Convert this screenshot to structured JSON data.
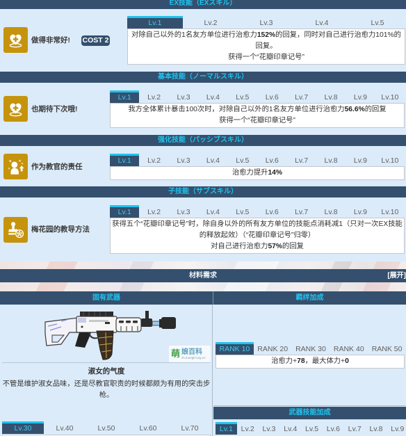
{
  "theme": {
    "header_bg": "#34506e",
    "header_text": "#1fc3ee",
    "accent": "#1fc3ee",
    "active_tab_text": "#45c7ef",
    "icon_bg": "#c6930d",
    "page_bg": "#dcebf9"
  },
  "skills": [
    {
      "header": "EX技能（EXスキル）",
      "icon": "heal-heart-icon",
      "name": "做得非常好!",
      "cost": "COST 2",
      "levels": {
        "labels": [
          "Lv.1",
          "Lv.2",
          "Lv.3",
          "Lv.4",
          "Lv.5"
        ],
        "active": 0
      },
      "description": [
        [
          {
            "text": "对除自己以外的1名友方单位进行治愈力",
            "bold": false
          },
          {
            "text": "152%",
            "bold": true
          },
          {
            "text": "的回复，同时对自己进行治愈力101%的回复。",
            "bold": false
          }
        ],
        [
          {
            "text": "获得一个“花瓣印章记号”",
            "bold": false
          }
        ]
      ]
    },
    {
      "header": "基本技能（ノーマルスキル）",
      "icon": "heal-heart-icon",
      "name": "也期待下次哦!",
      "levels": {
        "labels": [
          "Lv.1",
          "Lv.2",
          "Lv.3",
          "Lv.4",
          "Lv.5",
          "Lv.6",
          "Lv.7",
          "Lv.8",
          "Lv.9",
          "Lv.10"
        ],
        "active": 0
      },
      "description": [
        [
          {
            "text": "我方全体累计暴击100次时，对除自己以外的1名友方单位进行治愈力",
            "bold": false
          },
          {
            "text": "56.6%",
            "bold": true
          },
          {
            "text": "的回复",
            "bold": false
          }
        ],
        [
          {
            "text": "获得一个“花瓣印章记号”",
            "bold": false
          }
        ]
      ]
    },
    {
      "header": "强化技能（パッシブスキル）",
      "icon": "buff-figure-icon",
      "name": "作为教官的责任",
      "levels": {
        "labels": [
          "Lv.1",
          "Lv.2",
          "Lv.3",
          "Lv.4",
          "Lv.5",
          "Lv.6",
          "Lv.7",
          "Lv.8",
          "Lv.9",
          "Lv.10"
        ],
        "active": 0
      },
      "description": [
        [
          {
            "text": "治愈力提升",
            "bold": false
          },
          {
            "text": "14%",
            "bold": true
          }
        ]
      ]
    },
    {
      "header": "子技能（サブスキル）",
      "icon": "stamp-icon",
      "name": "梅花园的教导方法",
      "levels": {
        "labels": [
          "Lv.1",
          "Lv.2",
          "Lv.3",
          "Lv.4",
          "Lv.5",
          "Lv.6",
          "Lv.7",
          "Lv.8",
          "Lv.9",
          "Lv.10"
        ],
        "active": 0
      },
      "description": [
        [
          {
            "text": "获得五个“花瓣印章记号”时，除自身以外的所有友方单位的技能点消耗减1（只对一次EX技能的释放起效）（“花瓣印章记号”归零）",
            "bold": false
          }
        ],
        [
          {
            "text": "对自己进行治愈力",
            "bold": false
          },
          {
            "text": "57%",
            "bold": true
          },
          {
            "text": "的回复",
            "bold": false
          }
        ]
      ]
    }
  ],
  "materials": {
    "header": "材料需求",
    "toggle": "[展开]"
  },
  "weapon": {
    "header": "固有武器",
    "image_icon": "assault-rifle-icon",
    "watermark": {
      "logo": "萌",
      "name": "娘百科",
      "url": "zh.moegirl.org.cn"
    },
    "name": "淑女的气度",
    "description": "不管是维护淑女品味，还是尽教官职责的时候都颇为有用的突击步枪。",
    "levels": {
      "labels": [
        "Lv.30",
        "Lv.40",
        "Lv.50",
        "Lv.60",
        "Lv.70"
      ],
      "active": 0
    }
  },
  "bond": {
    "header": "羁绊加成",
    "ranks": {
      "labels": [
        "RANK 10",
        "RANK 20",
        "RANK 30",
        "RANK 40",
        "RANK 50"
      ],
      "active": 0
    },
    "description": [
      [
        {
          "text": "治愈力+",
          "bold": false
        },
        {
          "text": "78",
          "bold": true
        },
        {
          "text": "，最大体力+",
          "bold": false
        },
        {
          "text": "0",
          "bold": true
        }
      ]
    ]
  },
  "weapon_skill": {
    "header": "武器技能加成",
    "levels": {
      "labels": [
        "Lv.1",
        "Lv.2",
        "Lv.3",
        "Lv.4",
        "Lv.5",
        "Lv.6",
        "Lv.7",
        "Lv.8",
        "Lv.9"
      ],
      "active": 0
    }
  }
}
